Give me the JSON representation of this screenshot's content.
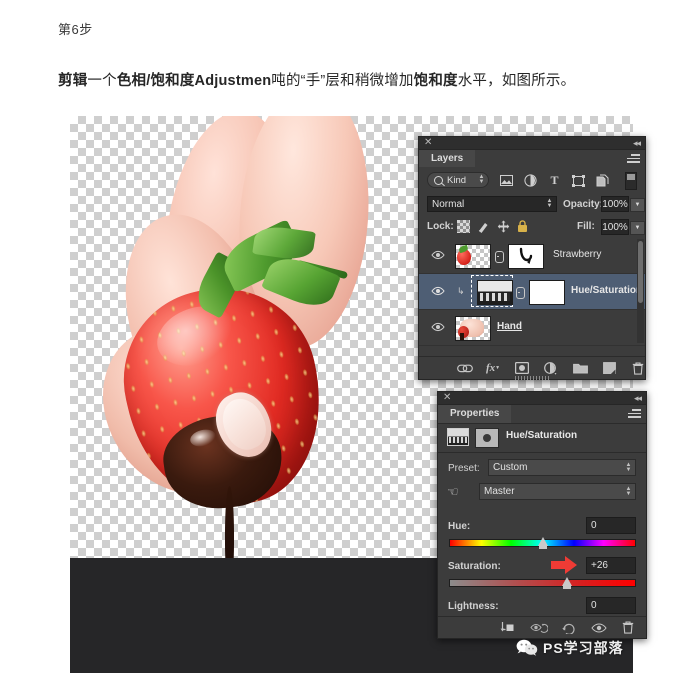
{
  "article": {
    "step_label": "第6步",
    "desc_bold_1": "剪辑",
    "desc_thin_1": "一个",
    "desc_bold_2": "色相/饱和度Adjustmen",
    "desc_thin_2": "吨的“手”层和稍微增加",
    "desc_bold_3": "饱和度",
    "desc_thin_3": "水平，如图所示。",
    "desc_full": "剪辑一个色相/饱和度Adjustmen吨的“手”层和稍微增加饱和度水平，如图所示。"
  },
  "layers_panel": {
    "tab_label": "Layers",
    "close_icon": "close-icon",
    "collapse_icon": "collapse-icon",
    "menu_icon": "panel-menu-icon",
    "filter": {
      "kind_label": "Kind",
      "search_icon": "search-icon",
      "icons": [
        "pixel-layer-icon",
        "adjustment-layer-icon",
        "type-layer-icon",
        "shape-layer-icon",
        "smart-object-icon"
      ],
      "toggle_icon": "filter-toggle-icon"
    },
    "blend_mode": "Normal",
    "opacity_label": "Opacity:",
    "opacity_value": "100%",
    "lock_label": "Lock:",
    "lock_icons": [
      "lock-transparency-icon",
      "lock-image-icon",
      "lock-position-icon",
      "lock-all-icon"
    ],
    "fill_label": "Fill:",
    "fill_value": "100%",
    "layers": [
      {
        "name": "Strawberry",
        "selected": false,
        "has_mask": true,
        "has_link": true,
        "clipped": false
      },
      {
        "name": "Hue/Saturation",
        "selected": true,
        "has_mask": true,
        "has_link": true,
        "clipped": true
      },
      {
        "name": "Hand",
        "selected": false,
        "has_mask": false,
        "has_link": false,
        "clipped": false
      }
    ],
    "bottom_icons": [
      "link-layers-icon",
      "layer-style-fx-icon",
      "add-mask-icon",
      "new-adjustment-icon",
      "new-group-icon",
      "new-layer-icon",
      "delete-layer-icon"
    ]
  },
  "properties_panel": {
    "tab_label": "Properties",
    "title": "Hue/Saturation",
    "adjustment_icon": "hue-saturation-icon",
    "preset_label": "Preset:",
    "preset_value": "Custom",
    "hand_icon": "on-image-adjust-icon",
    "channel_value": "Master",
    "sliders": [
      {
        "label": "Hue:",
        "value": "0",
        "pos_pct": 50,
        "track": "hue"
      },
      {
        "label": "Saturation:",
        "value": "+26",
        "pos_pct": 63,
        "track": "saturation"
      },
      {
        "label": "Lightness:",
        "value": "0",
        "pos_pct": 50,
        "track": "lightness"
      }
    ],
    "bottom_icons": [
      "clip-to-layer-icon",
      "view-previous-state-icon",
      "reset-icon",
      "toggle-visibility-icon",
      "delete-adjustment-icon"
    ]
  },
  "cursor": {
    "name": "red-arrow-cursor"
  },
  "watermark": {
    "text": "PS学习部落",
    "icon": "wechat-icon"
  },
  "colors": {
    "panel_bg": "#3c3c3c",
    "panel_dark": "#2e2e2e",
    "selected_row": "#4e5e74",
    "field_bg": "#272727",
    "accent_red": "#ef3b35",
    "canvas_band": "#262628"
  }
}
